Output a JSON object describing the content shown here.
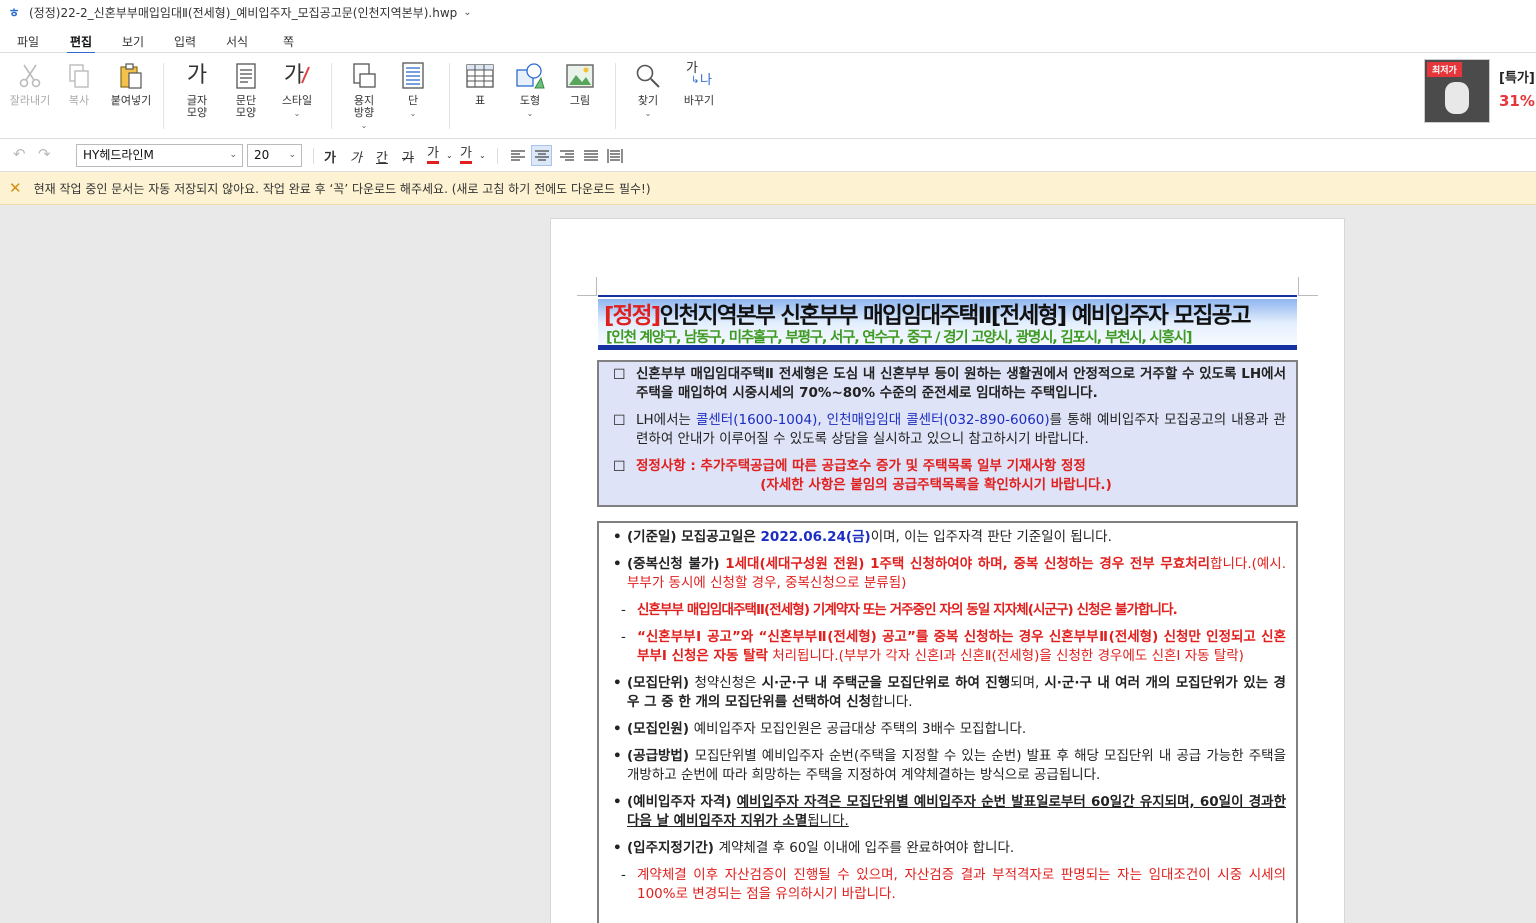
{
  "window": {
    "title": "(정정)22-2_신혼부부매입임대Ⅱ(전세형)_예비입주자_모집공고문(인천지역본부).hwp"
  },
  "menu": {
    "tabs": [
      "파일",
      "편집",
      "보기",
      "입력",
      "서식",
      "쪽"
    ],
    "active": "편집"
  },
  "ribbon": {
    "cut": "잘라내기",
    "copy": "복사",
    "paste": "붙여넣기",
    "char_shape": "글자\n모양",
    "para_shape": "문단\n모양",
    "style": "스타일",
    "page_dir": "용지\n방향",
    "column": "단",
    "table": "표",
    "shape": "도형",
    "image": "그림",
    "find": "찾기",
    "replace": "바꾸기",
    "ga_glyph": "가",
    "ga_na_glyph_1": "가",
    "ga_na_glyph_2": "나"
  },
  "ad": {
    "tag": "최저가",
    "line1": "[특가]",
    "line2": "31%"
  },
  "format": {
    "font": "HY헤드라인M",
    "size": "20",
    "bold": "가",
    "italic": "가",
    "underline": "간",
    "strike": "가",
    "color": "가",
    "highlight": "가"
  },
  "notice": {
    "text": "현재 작업 중인 문서는 자동 저장되지 않아요. 작업 완료 후 ‘꼭’ 다운로드 해주세요. (새로 고침 하기 전에도 다운로드 필수!)"
  },
  "doc": {
    "title_tag": "[정정]",
    "title_main": "인천지역본부 신혼부부 매입임대주택Ⅱ[전세형] 예비입주자 모집공고",
    "subtitle": "[인천 계양구, 남동구, 미추홀구, 부평구, 서구, 연수구, 중구 / 경기 고양시, 광명시, 김포시, 부천시, 시흥시]",
    "intro": {
      "p1": "신혼부부 매입임대주택Ⅱ 전세형은 도심 내 신혼부부 등이 원하는 생활권에서 안정적으로 거주할 수 있도록 LH에서 주택을 매입하여 시중시세의 70%~80% 수준의 준전세로 임대하는 주택입니다.",
      "p2_a": "LH에서는 ",
      "p2_b": "콜센터(1600-1004), 인천매입임대 콜센터(032-890-6060)",
      "p2_c": "를 통해 예비입주자 모집공고의 내용과 관련하여 안내가 이루어질 수 있도록 상담을 실시하고 있으니 참고하시기 바랍니다.",
      "p3_a": "정정사항 : 추가주택공급에 따른 공급호수 증가 및 주택목록 일부 기재사항 정정",
      "p3_b": "(자세한 사항은 붙임의 공급주택목록을 확인하시기 바랍니다.)"
    },
    "rules": {
      "r1_a": "(기준일) 모집공고일은 ",
      "r1_b": "2022.06.24(금)",
      "r1_c": "이며, 이는 입주자격 판단 기준일이 됩니다.",
      "r2_a": "(중복신청 불가) ",
      "r2_b": "1세대(세대구성원 전원) 1주택 신청하여야 하며, 중복 신청하는 경우 전부 무효처리",
      "r2_c": "합니다.(예시. 부부가 동시에 신청할 경우, 중복신청으로 분류됨)",
      "r3": "신혼부부 매입임대주택Ⅱ(전세형) 기계약자 또는 거주중인 자의 동일 지자체(시군구) 신청은 불가합니다.",
      "r4_a": "“신혼부부Ⅰ 공고”와 “신혼부부Ⅱ(전세형) 공고”를 중복 신청하는 경우 신혼부부Ⅱ(전세형) 신청만 인정되고 신혼부부Ⅰ 신청은 자동 탈락",
      "r4_b": " 처리됩니다.(부부가 각자 신혼Ⅰ과 신혼Ⅱ(전세형)을 신청한 경우에도 신혼Ⅰ 자동 탈락)",
      "r5_a": "(모집단위) ",
      "r5_b": "청약신청은 ",
      "r5_c": "시·군·구 내 주택군을 모집단위로 하여 진행",
      "r5_d": "되며, ",
      "r5_e": "시·군·구 내 여러 개의 모집단위가 있는 경우 그 중 한 개의 모집단위를 선택하여 신청",
      "r5_f": "합니다.",
      "r6_a": "(모집인원) ",
      "r6_b": "예비입주자 모집인원은 공급대상 주택의 3배수 모집합니다.",
      "r7_a": "(공급방법) ",
      "r7_b": "모집단위별 예비입주자 순번(주택을 지정할 수 있는 순번) 발표 후 해당 모집단위 내 공급 가능한 주택을 개방하고 순번에 따라 희망하는 주택을 지정하여 계약체결하는 방식으로 공급됩니다.",
      "r8_a": "(예비입주자 자격) ",
      "r8_b": "예비입주자 자격은 모집단위별 예비입주자 순번 발표일로부터 60일간 유지되며, 60일이 경과한 다음 날 예비입주자 지위가 소멸",
      "r8_c": "됩니다.",
      "r9_a": "(입주지정기간) ",
      "r9_b": "계약체결 후 60일 이내에 입주를 완료하여야 합니다.",
      "r10": "계약체결 이후 자산검증이 진행될 수 있으며, 자산검증 결과 부적격자로 판명되는 자는 임대조건이 시중 시세의 100%로 변경되는 점을 유의하시기 바랍니다."
    }
  }
}
